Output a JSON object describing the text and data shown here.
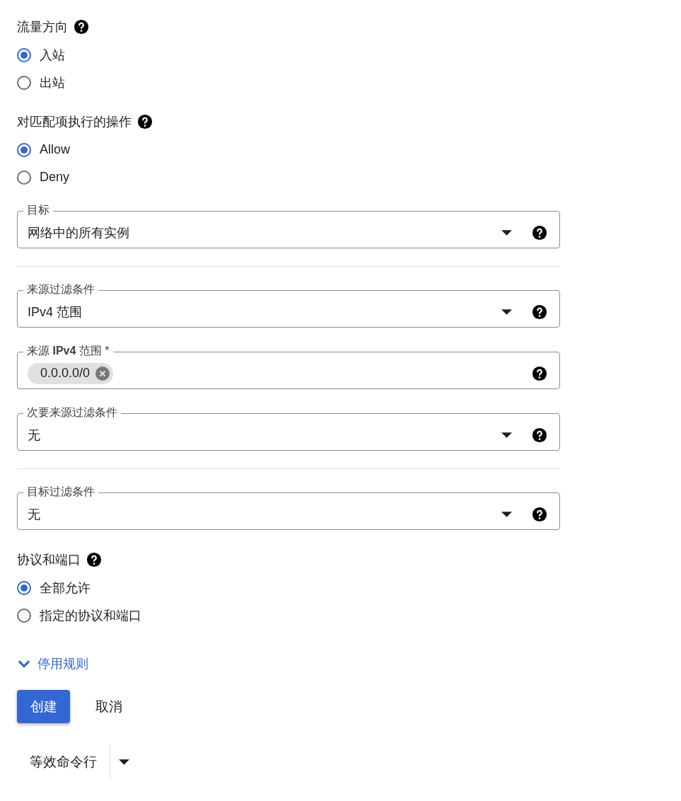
{
  "sections": [
    {
      "kind": "radio-group",
      "title": "流量方向",
      "help": true,
      "options": [
        {
          "label": "入站",
          "selected": true
        },
        {
          "label": "出站",
          "selected": false
        }
      ]
    },
    {
      "kind": "radio-group",
      "title": "对匹配项执行的操作",
      "help": true,
      "options": [
        {
          "label": "Allow",
          "selected": true
        },
        {
          "label": "Deny",
          "selected": false
        }
      ]
    },
    {
      "kind": "select",
      "label": "目标",
      "value": "网络中的所有实例"
    },
    {
      "kind": "divider"
    },
    {
      "kind": "select",
      "label": "来源过滤条件",
      "value": "IPv4 范围"
    },
    {
      "kind": "chips",
      "label": "来源 **IPv4** 范围 *",
      "chips": [
        "0.0.0.0/0"
      ]
    },
    {
      "kind": "select",
      "label": "次要来源过滤条件",
      "value": "无"
    },
    {
      "kind": "divider"
    },
    {
      "kind": "select",
      "label": "目标过滤条件",
      "value": "无"
    },
    {
      "kind": "radio-group",
      "title": "协议和端口",
      "help": true,
      "options": [
        {
          "label": "全部允许",
          "selected": true
        },
        {
          "label": "指定的协议和端口",
          "selected": false
        }
      ]
    }
  ],
  "disclosure": {
    "label": "停用规则",
    "expanded": false
  },
  "buttons": {
    "primary": "创建",
    "secondary": "取消"
  },
  "command_line": {
    "label": "等效命令行"
  }
}
